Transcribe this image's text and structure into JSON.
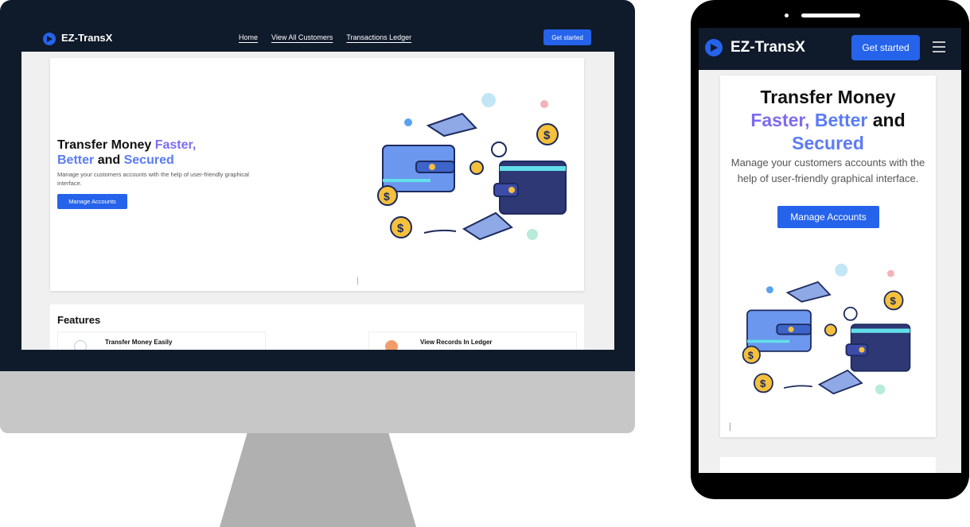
{
  "brand": {
    "name": "EZ-TransX",
    "logo_icon": "play-circle-icon",
    "accent": "#2563eb",
    "nav_bg": "#0f1a2b"
  },
  "desktop": {
    "nav_links": [
      "Home",
      "View All Customers",
      "Transactions Ledger"
    ],
    "get_started": "Get started",
    "hero": {
      "title_plain": "Transfer Money",
      "title_faster": "Faster,",
      "title_better": "Better",
      "title_and": "and",
      "title_secured": "Secured",
      "subtitle": "Manage your customers accounts with the help of user-friendly graphical interface.",
      "cta": "Manage Accounts"
    },
    "features": {
      "title": "Features",
      "items": [
        "Transfer Money Easily",
        "View Records In Ledger"
      ]
    }
  },
  "mobile": {
    "get_started": "Get started",
    "menu_icon": "hamburger-menu-icon",
    "hero": {
      "title_plain": "Transfer Money",
      "title_faster": "Faster,",
      "title_better": "Better",
      "title_and": "and",
      "title_secured": "Secured",
      "subtitle": "Manage your customers accounts with the help of user-friendly graphical interface.",
      "cta": "Manage Accounts"
    }
  }
}
